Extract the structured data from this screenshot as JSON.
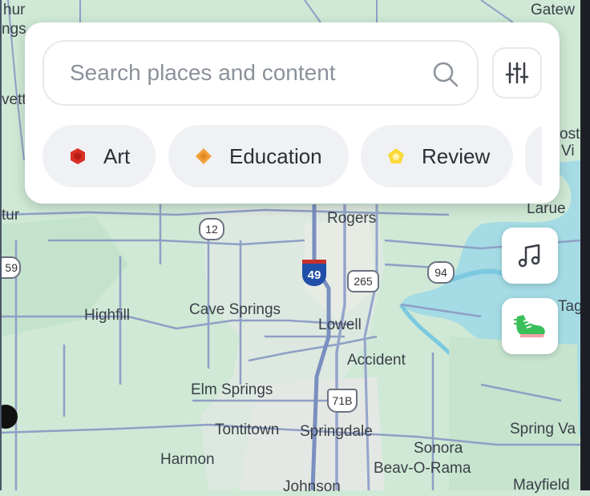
{
  "search": {
    "placeholder": "Search places and content"
  },
  "filter": {
    "icon": "sliders-icon"
  },
  "categories": [
    {
      "label": "Art",
      "icon": "hexagon-icon",
      "color": "#d93025"
    },
    {
      "label": "Education",
      "icon": "diamond-icon",
      "color": "#f0a03a"
    },
    {
      "label": "Review",
      "icon": "pentagon-icon",
      "color": "#fbd93a"
    }
  ],
  "map": {
    "places": [
      "Rogers",
      "Cave Springs",
      "Lowell",
      "Highfill",
      "Accident",
      "Elm Springs",
      "Tontitown",
      "Springdale",
      "Sonora",
      "Harmon",
      "Beav-O-Rama",
      "Johnson",
      "Larue",
      "Gatew",
      "hur",
      "ngs",
      "vett",
      "tur",
      "ost",
      "Vi",
      "Tag",
      "Spring Va",
      "Mayfield"
    ],
    "route_shields": [
      "12",
      "49",
      "265",
      "94",
      "71B",
      "59"
    ]
  },
  "side_buttons": [
    {
      "name": "music-button",
      "icon": "music-note-icon"
    },
    {
      "name": "activity-button",
      "icon": "sneaker-icon"
    }
  ]
}
